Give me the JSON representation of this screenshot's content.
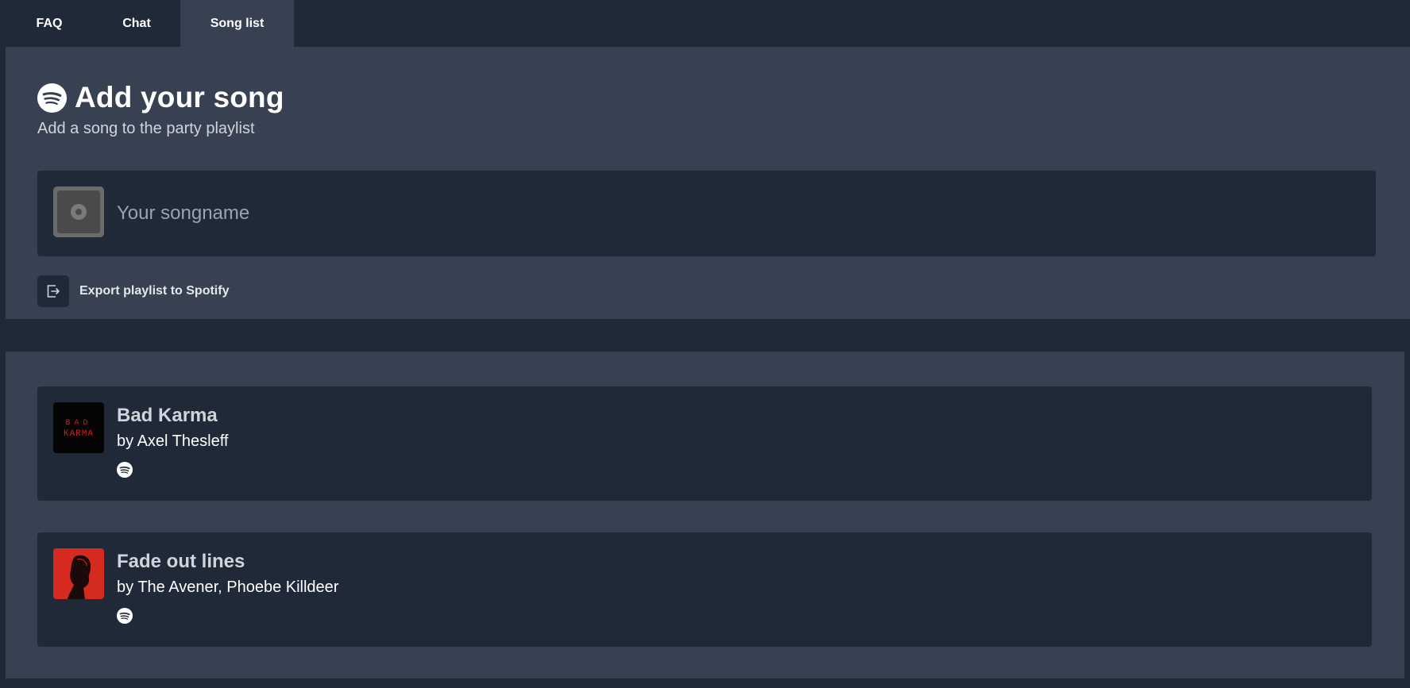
{
  "tabs": [
    {
      "label": "FAQ"
    },
    {
      "label": "Chat"
    },
    {
      "label": "Song list",
      "active": true
    }
  ],
  "header": {
    "icon": "spotify-icon",
    "title": "Add your song",
    "subtitle": "Add a song to the party playlist"
  },
  "search": {
    "placeholder": "Your songname",
    "value": "",
    "icon": "vinyl-record-icon"
  },
  "export": {
    "icon": "export-icon",
    "label": "Export playlist to Spotify"
  },
  "songs": [
    {
      "title": "Bad Karma",
      "artist": "by Axel Thesleff",
      "cover_text": "B A D KARMA",
      "service_icon": "spotify-icon"
    },
    {
      "title": "Fade out lines",
      "artist": "by The Avener, Phoebe Killdeer",
      "service_icon": "spotify-icon"
    }
  ],
  "colors": {
    "background": "#202938",
    "panel": "#374151",
    "accent_red": "#d42a1f"
  }
}
